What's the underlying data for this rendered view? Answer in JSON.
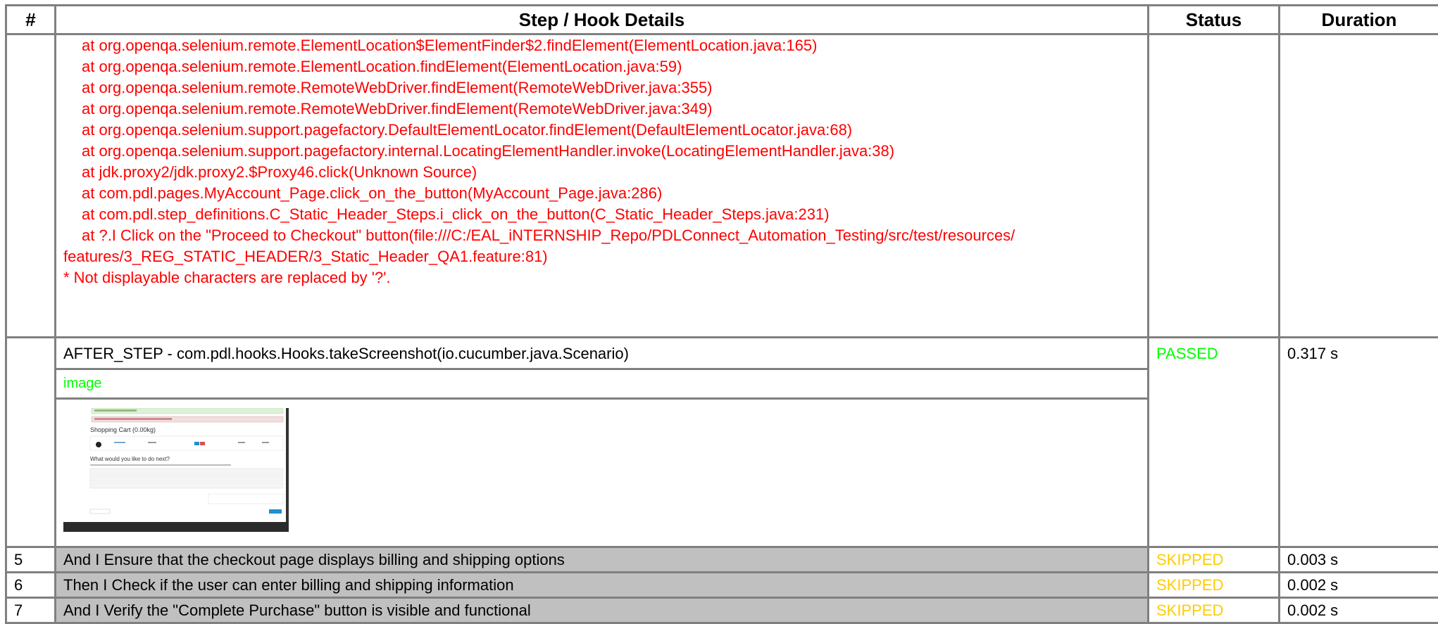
{
  "headers": {
    "num": "#",
    "details": "Step / Hook Details",
    "status": "Status",
    "duration": "Duration"
  },
  "trace_lines": [
    "at org.openqa.selenium.remote.ElementLocation$ElementFinder$2.findElement(ElementLocation.java:165)",
    "at org.openqa.selenium.remote.ElementLocation.findElement(ElementLocation.java:59)",
    "at org.openqa.selenium.remote.RemoteWebDriver.findElement(RemoteWebDriver.java:355)",
    "at org.openqa.selenium.remote.RemoteWebDriver.findElement(RemoteWebDriver.java:349)",
    "at org.openqa.selenium.support.pagefactory.DefaultElementLocator.findElement(DefaultElementLocator.java:68)",
    "at org.openqa.selenium.support.pagefactory.internal.LocatingElementHandler.invoke(LocatingElementHandler.java:38)",
    "at jdk.proxy2/jdk.proxy2.$Proxy46.click(Unknown Source)",
    "at com.pdl.pages.MyAccount_Page.click_on_the_button(MyAccount_Page.java:286)",
    "at com.pdl.step_definitions.C_Static_Header_Steps.i_click_on_the_button(C_Static_Header_Steps.java:231)"
  ],
  "trace_last_1": "at ?.I Click on the \"Proceed to Checkout\" button(file:///C:/EAL_iNTERNSHIP_Repo/PDLConnect_Automation_Testing/src/test/resources/",
  "trace_last_2": "features/3_REG_STATIC_HEADER/3_Static_Header_QA1.feature:81)",
  "trace_note": "* Not displayable characters are replaced by '?'.",
  "hook": {
    "text": "AFTER_STEP - com.pdl.hooks.Hooks.takeScreenshot(io.cucumber.java.Scenario)",
    "status": "PASSED",
    "duration": "0.317 s",
    "image_label": "image"
  },
  "thumbnail": {
    "title": "Shopping Cart  (0.00kg)",
    "next_heading": "What would you like to do next?"
  },
  "steps": [
    {
      "num": "5",
      "text": "And I Ensure that the checkout page displays billing and shipping options",
      "status": "SKIPPED",
      "duration": "0.003 s"
    },
    {
      "num": "6",
      "text": "Then I Check if the user can enter billing and shipping information",
      "status": "SKIPPED",
      "duration": "0.002 s"
    },
    {
      "num": "7",
      "text": "And I Verify the \"Complete Purchase\" button is visible and functional",
      "status": "SKIPPED",
      "duration": "0.002 s"
    }
  ],
  "colors": {
    "trace": "#ff0000",
    "passed": "#00ff00",
    "skipped": "#ffcc00",
    "step_bg": "#c0c0c0",
    "border": "#808080"
  }
}
